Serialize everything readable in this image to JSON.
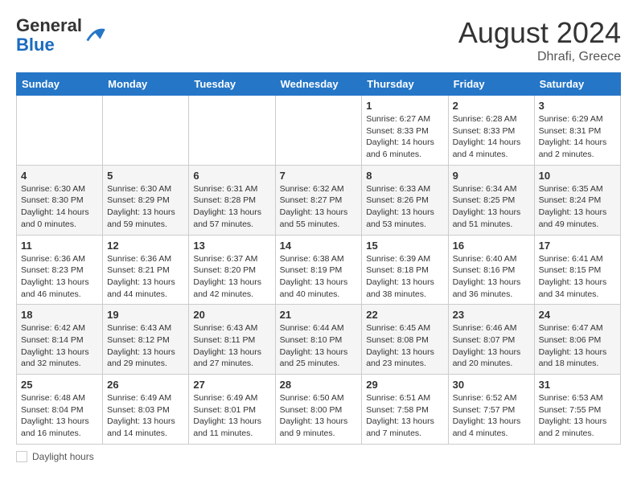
{
  "header": {
    "logo_line1": "General",
    "logo_line2": "Blue",
    "month_year": "August 2024",
    "location": "Dhrafi, Greece"
  },
  "days_of_week": [
    "Sunday",
    "Monday",
    "Tuesday",
    "Wednesday",
    "Thursday",
    "Friday",
    "Saturday"
  ],
  "weeks": [
    [
      {
        "day": "",
        "info": ""
      },
      {
        "day": "",
        "info": ""
      },
      {
        "day": "",
        "info": ""
      },
      {
        "day": "",
        "info": ""
      },
      {
        "day": "1",
        "info": "Sunrise: 6:27 AM\nSunset: 8:33 PM\nDaylight: 14 hours\nand 6 minutes."
      },
      {
        "day": "2",
        "info": "Sunrise: 6:28 AM\nSunset: 8:33 PM\nDaylight: 14 hours\nand 4 minutes."
      },
      {
        "day": "3",
        "info": "Sunrise: 6:29 AM\nSunset: 8:31 PM\nDaylight: 14 hours\nand 2 minutes."
      }
    ],
    [
      {
        "day": "4",
        "info": "Sunrise: 6:30 AM\nSunset: 8:30 PM\nDaylight: 14 hours\nand 0 minutes."
      },
      {
        "day": "5",
        "info": "Sunrise: 6:30 AM\nSunset: 8:29 PM\nDaylight: 13 hours\nand 59 minutes."
      },
      {
        "day": "6",
        "info": "Sunrise: 6:31 AM\nSunset: 8:28 PM\nDaylight: 13 hours\nand 57 minutes."
      },
      {
        "day": "7",
        "info": "Sunrise: 6:32 AM\nSunset: 8:27 PM\nDaylight: 13 hours\nand 55 minutes."
      },
      {
        "day": "8",
        "info": "Sunrise: 6:33 AM\nSunset: 8:26 PM\nDaylight: 13 hours\nand 53 minutes."
      },
      {
        "day": "9",
        "info": "Sunrise: 6:34 AM\nSunset: 8:25 PM\nDaylight: 13 hours\nand 51 minutes."
      },
      {
        "day": "10",
        "info": "Sunrise: 6:35 AM\nSunset: 8:24 PM\nDaylight: 13 hours\nand 49 minutes."
      }
    ],
    [
      {
        "day": "11",
        "info": "Sunrise: 6:36 AM\nSunset: 8:23 PM\nDaylight: 13 hours\nand 46 minutes."
      },
      {
        "day": "12",
        "info": "Sunrise: 6:36 AM\nSunset: 8:21 PM\nDaylight: 13 hours\nand 44 minutes."
      },
      {
        "day": "13",
        "info": "Sunrise: 6:37 AM\nSunset: 8:20 PM\nDaylight: 13 hours\nand 42 minutes."
      },
      {
        "day": "14",
        "info": "Sunrise: 6:38 AM\nSunset: 8:19 PM\nDaylight: 13 hours\nand 40 minutes."
      },
      {
        "day": "15",
        "info": "Sunrise: 6:39 AM\nSunset: 8:18 PM\nDaylight: 13 hours\nand 38 minutes."
      },
      {
        "day": "16",
        "info": "Sunrise: 6:40 AM\nSunset: 8:16 PM\nDaylight: 13 hours\nand 36 minutes."
      },
      {
        "day": "17",
        "info": "Sunrise: 6:41 AM\nSunset: 8:15 PM\nDaylight: 13 hours\nand 34 minutes."
      }
    ],
    [
      {
        "day": "18",
        "info": "Sunrise: 6:42 AM\nSunset: 8:14 PM\nDaylight: 13 hours\nand 32 minutes."
      },
      {
        "day": "19",
        "info": "Sunrise: 6:43 AM\nSunset: 8:12 PM\nDaylight: 13 hours\nand 29 minutes."
      },
      {
        "day": "20",
        "info": "Sunrise: 6:43 AM\nSunset: 8:11 PM\nDaylight: 13 hours\nand 27 minutes."
      },
      {
        "day": "21",
        "info": "Sunrise: 6:44 AM\nSunset: 8:10 PM\nDaylight: 13 hours\nand 25 minutes."
      },
      {
        "day": "22",
        "info": "Sunrise: 6:45 AM\nSunset: 8:08 PM\nDaylight: 13 hours\nand 23 minutes."
      },
      {
        "day": "23",
        "info": "Sunrise: 6:46 AM\nSunset: 8:07 PM\nDaylight: 13 hours\nand 20 minutes."
      },
      {
        "day": "24",
        "info": "Sunrise: 6:47 AM\nSunset: 8:06 PM\nDaylight: 13 hours\nand 18 minutes."
      }
    ],
    [
      {
        "day": "25",
        "info": "Sunrise: 6:48 AM\nSunset: 8:04 PM\nDaylight: 13 hours\nand 16 minutes."
      },
      {
        "day": "26",
        "info": "Sunrise: 6:49 AM\nSunset: 8:03 PM\nDaylight: 13 hours\nand 14 minutes."
      },
      {
        "day": "27",
        "info": "Sunrise: 6:49 AM\nSunset: 8:01 PM\nDaylight: 13 hours\nand 11 minutes."
      },
      {
        "day": "28",
        "info": "Sunrise: 6:50 AM\nSunset: 8:00 PM\nDaylight: 13 hours\nand 9 minutes."
      },
      {
        "day": "29",
        "info": "Sunrise: 6:51 AM\nSunset: 7:58 PM\nDaylight: 13 hours\nand 7 minutes."
      },
      {
        "day": "30",
        "info": "Sunrise: 6:52 AM\nSunset: 7:57 PM\nDaylight: 13 hours\nand 4 minutes."
      },
      {
        "day": "31",
        "info": "Sunrise: 6:53 AM\nSunset: 7:55 PM\nDaylight: 13 hours\nand 2 minutes."
      }
    ]
  ],
  "footer": {
    "label": "Daylight hours"
  }
}
